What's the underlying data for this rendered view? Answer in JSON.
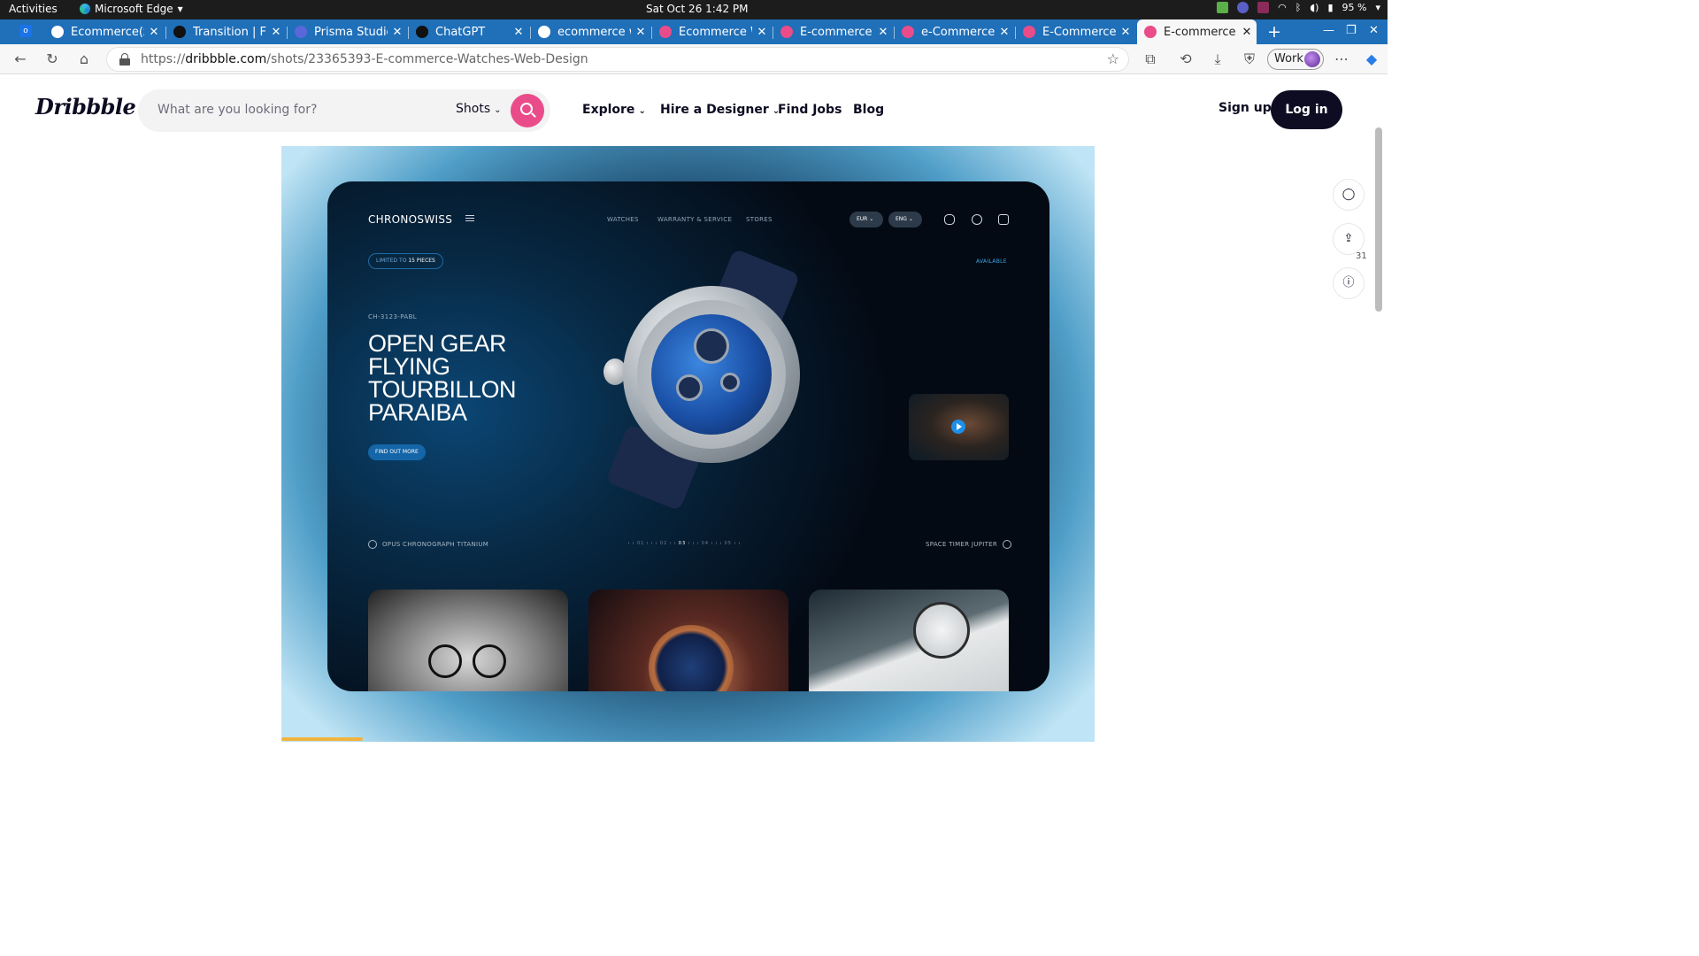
{
  "system_bar": {
    "activities": "Activities",
    "app_name": "Microsoft Edge",
    "clock": "Sat Oct 26  1:42 PM",
    "battery": "95 %"
  },
  "tabs": [
    {
      "title": "Ecommerce(z)",
      "color": "#ffffff"
    },
    {
      "title": "Transition | Fram",
      "color": "#111111"
    },
    {
      "title": "Prisma Studio",
      "color": "#5a67d8"
    },
    {
      "title": "ChatGPT",
      "color": "#111111"
    },
    {
      "title": "ecommerce web",
      "color": "#ffffff"
    },
    {
      "title": "Ecommerce We",
      "color": "#ea4c89"
    },
    {
      "title": "E-commerce We",
      "color": "#ea4c89"
    },
    {
      "title": "e-Commerce we",
      "color": "#ea4c89"
    },
    {
      "title": "E-Commerce we",
      "color": "#ea4c89"
    },
    {
      "title": "E-commerce We",
      "color": "#ea4c89",
      "active": true
    }
  ],
  "address_bar": {
    "url_prefix": "https://",
    "url_domain": "dribbble.com",
    "url_path": "/shots/23365393-E-commerce-Watches-Web-Design",
    "profile_label": "Work"
  },
  "dribbble": {
    "logo": "Dribbble",
    "search_placeholder": "What are you looking for?",
    "search_scope": "Shots",
    "nav": {
      "explore": "Explore",
      "hire": "Hire a Designer",
      "jobs": "Find Jobs",
      "blog": "Blog"
    },
    "sign_up": "Sign up",
    "log_in": "Log in",
    "comment_count": "31",
    "accent_color": "#ea4c89"
  },
  "shot": {
    "brand": "CHRONOSWISS",
    "nav": [
      "WATCHES",
      "WARRANTY & SERVICE",
      "STORES"
    ],
    "currency": "EUR",
    "language": "ENG",
    "badge_prefix": "LIMITED TO",
    "badge_count": "15 PIECES",
    "availability": "AVAILABLE",
    "sku": "CH-3123-PABL",
    "headline": [
      "OPEN GEAR",
      "FLYING",
      "TOURBILLON",
      "PARAIBA"
    ],
    "cta": "FIND OUT MORE",
    "prev_model": "OPUS CHRONOGRAPH TITANIUM",
    "next_model": "SPACE TIMER JUPITER",
    "pager": [
      "01",
      "02",
      "03",
      "04",
      "05"
    ],
    "pager_active": "03",
    "slideshow_progress": 0.1
  }
}
